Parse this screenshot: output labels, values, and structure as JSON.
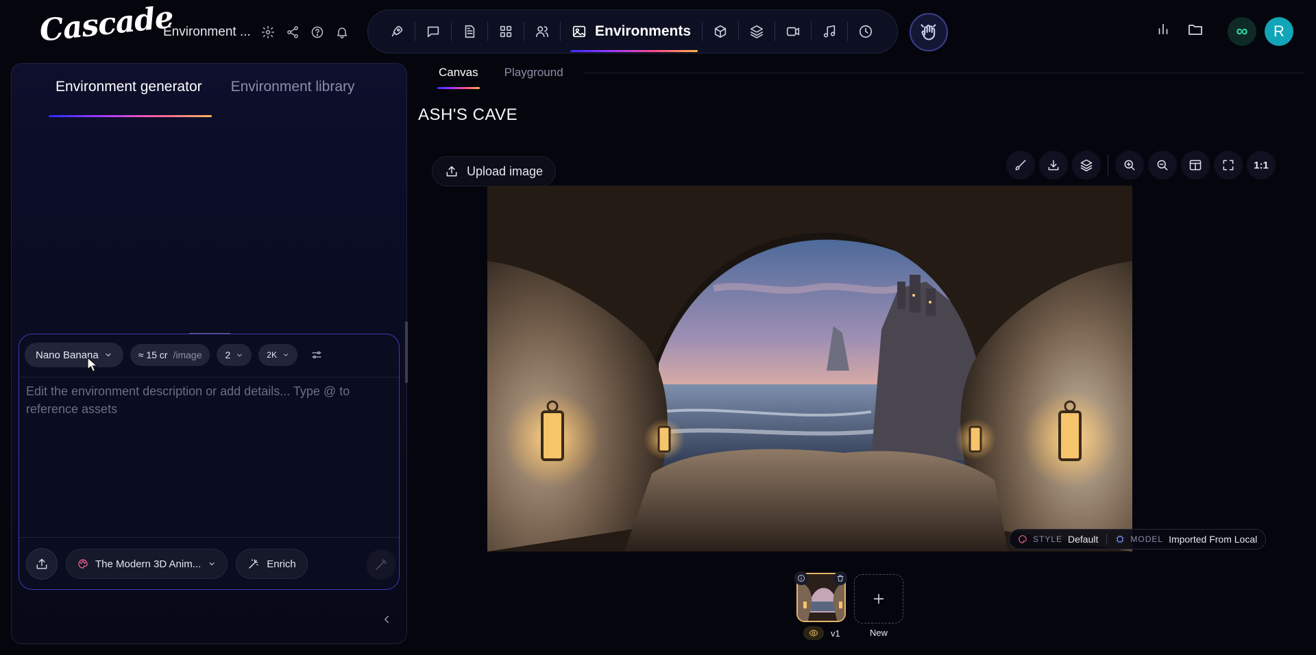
{
  "app": {
    "logo_text": "Cascade",
    "project_title": "Environment ...",
    "active_section": "Environments",
    "avatar_initial": "R",
    "accent_gradient": [
      "#3b2cff",
      "#a13bff",
      "#ff4d8a",
      "#ffb14a"
    ]
  },
  "left_panel": {
    "tabs": [
      "Environment generator",
      "Environment library"
    ],
    "model_chip": "Nano Banana",
    "cost_value": "≈ 15 cr",
    "cost_unit": "/image",
    "count_value": "2",
    "resolution_value": "2K",
    "prompt_placeholder": "Edit the environment description or add details... Type @ to reference assets",
    "prompt_value": "",
    "style_chip": "The Modern 3D Anim...",
    "enrich_label": "Enrich"
  },
  "canvas": {
    "tabs": [
      "Canvas",
      "Playground"
    ],
    "title": "ASH'S CAVE",
    "upload_label": "Upload image",
    "ratio_label": "1:1",
    "meta": {
      "style_key": "STYLE",
      "style_value": "Default",
      "model_key": "MODEL",
      "model_value": "Imported From Local"
    },
    "versions": [
      {
        "label": "v1"
      }
    ],
    "new_label": "New"
  }
}
